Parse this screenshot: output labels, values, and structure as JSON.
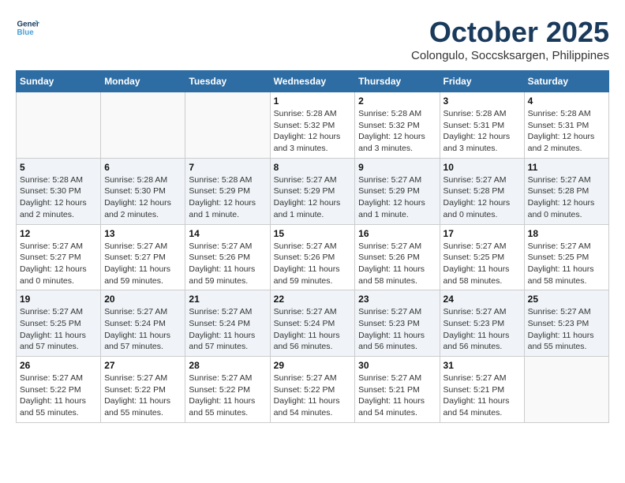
{
  "header": {
    "logo": {
      "line1": "General",
      "line2": "Blue"
    },
    "title": "October 2025",
    "subtitle": "Colongulo, Soccsksargen, Philippines"
  },
  "weekdays": [
    "Sunday",
    "Monday",
    "Tuesday",
    "Wednesday",
    "Thursday",
    "Friday",
    "Saturday"
  ],
  "weeks": [
    [
      {
        "day": "",
        "sunrise": "",
        "sunset": "",
        "daylight": ""
      },
      {
        "day": "",
        "sunrise": "",
        "sunset": "",
        "daylight": ""
      },
      {
        "day": "",
        "sunrise": "",
        "sunset": "",
        "daylight": ""
      },
      {
        "day": "1",
        "sunrise": "Sunrise: 5:28 AM",
        "sunset": "Sunset: 5:32 PM",
        "daylight": "Daylight: 12 hours and 3 minutes."
      },
      {
        "day": "2",
        "sunrise": "Sunrise: 5:28 AM",
        "sunset": "Sunset: 5:32 PM",
        "daylight": "Daylight: 12 hours and 3 minutes."
      },
      {
        "day": "3",
        "sunrise": "Sunrise: 5:28 AM",
        "sunset": "Sunset: 5:31 PM",
        "daylight": "Daylight: 12 hours and 3 minutes."
      },
      {
        "day": "4",
        "sunrise": "Sunrise: 5:28 AM",
        "sunset": "Sunset: 5:31 PM",
        "daylight": "Daylight: 12 hours and 2 minutes."
      }
    ],
    [
      {
        "day": "5",
        "sunrise": "Sunrise: 5:28 AM",
        "sunset": "Sunset: 5:30 PM",
        "daylight": "Daylight: 12 hours and 2 minutes."
      },
      {
        "day": "6",
        "sunrise": "Sunrise: 5:28 AM",
        "sunset": "Sunset: 5:30 PM",
        "daylight": "Daylight: 12 hours and 2 minutes."
      },
      {
        "day": "7",
        "sunrise": "Sunrise: 5:28 AM",
        "sunset": "Sunset: 5:29 PM",
        "daylight": "Daylight: 12 hours and 1 minute."
      },
      {
        "day": "8",
        "sunrise": "Sunrise: 5:27 AM",
        "sunset": "Sunset: 5:29 PM",
        "daylight": "Daylight: 12 hours and 1 minute."
      },
      {
        "day": "9",
        "sunrise": "Sunrise: 5:27 AM",
        "sunset": "Sunset: 5:29 PM",
        "daylight": "Daylight: 12 hours and 1 minute."
      },
      {
        "day": "10",
        "sunrise": "Sunrise: 5:27 AM",
        "sunset": "Sunset: 5:28 PM",
        "daylight": "Daylight: 12 hours and 0 minutes."
      },
      {
        "day": "11",
        "sunrise": "Sunrise: 5:27 AM",
        "sunset": "Sunset: 5:28 PM",
        "daylight": "Daylight: 12 hours and 0 minutes."
      }
    ],
    [
      {
        "day": "12",
        "sunrise": "Sunrise: 5:27 AM",
        "sunset": "Sunset: 5:27 PM",
        "daylight": "Daylight: 12 hours and 0 minutes."
      },
      {
        "day": "13",
        "sunrise": "Sunrise: 5:27 AM",
        "sunset": "Sunset: 5:27 PM",
        "daylight": "Daylight: 11 hours and 59 minutes."
      },
      {
        "day": "14",
        "sunrise": "Sunrise: 5:27 AM",
        "sunset": "Sunset: 5:26 PM",
        "daylight": "Daylight: 11 hours and 59 minutes."
      },
      {
        "day": "15",
        "sunrise": "Sunrise: 5:27 AM",
        "sunset": "Sunset: 5:26 PM",
        "daylight": "Daylight: 11 hours and 59 minutes."
      },
      {
        "day": "16",
        "sunrise": "Sunrise: 5:27 AM",
        "sunset": "Sunset: 5:26 PM",
        "daylight": "Daylight: 11 hours and 58 minutes."
      },
      {
        "day": "17",
        "sunrise": "Sunrise: 5:27 AM",
        "sunset": "Sunset: 5:25 PM",
        "daylight": "Daylight: 11 hours and 58 minutes."
      },
      {
        "day": "18",
        "sunrise": "Sunrise: 5:27 AM",
        "sunset": "Sunset: 5:25 PM",
        "daylight": "Daylight: 11 hours and 58 minutes."
      }
    ],
    [
      {
        "day": "19",
        "sunrise": "Sunrise: 5:27 AM",
        "sunset": "Sunset: 5:25 PM",
        "daylight": "Daylight: 11 hours and 57 minutes."
      },
      {
        "day": "20",
        "sunrise": "Sunrise: 5:27 AM",
        "sunset": "Sunset: 5:24 PM",
        "daylight": "Daylight: 11 hours and 57 minutes."
      },
      {
        "day": "21",
        "sunrise": "Sunrise: 5:27 AM",
        "sunset": "Sunset: 5:24 PM",
        "daylight": "Daylight: 11 hours and 57 minutes."
      },
      {
        "day": "22",
        "sunrise": "Sunrise: 5:27 AM",
        "sunset": "Sunset: 5:24 PM",
        "daylight": "Daylight: 11 hours and 56 minutes."
      },
      {
        "day": "23",
        "sunrise": "Sunrise: 5:27 AM",
        "sunset": "Sunset: 5:23 PM",
        "daylight": "Daylight: 11 hours and 56 minutes."
      },
      {
        "day": "24",
        "sunrise": "Sunrise: 5:27 AM",
        "sunset": "Sunset: 5:23 PM",
        "daylight": "Daylight: 11 hours and 56 minutes."
      },
      {
        "day": "25",
        "sunrise": "Sunrise: 5:27 AM",
        "sunset": "Sunset: 5:23 PM",
        "daylight": "Daylight: 11 hours and 55 minutes."
      }
    ],
    [
      {
        "day": "26",
        "sunrise": "Sunrise: 5:27 AM",
        "sunset": "Sunset: 5:22 PM",
        "daylight": "Daylight: 11 hours and 55 minutes."
      },
      {
        "day": "27",
        "sunrise": "Sunrise: 5:27 AM",
        "sunset": "Sunset: 5:22 PM",
        "daylight": "Daylight: 11 hours and 55 minutes."
      },
      {
        "day": "28",
        "sunrise": "Sunrise: 5:27 AM",
        "sunset": "Sunset: 5:22 PM",
        "daylight": "Daylight: 11 hours and 55 minutes."
      },
      {
        "day": "29",
        "sunrise": "Sunrise: 5:27 AM",
        "sunset": "Sunset: 5:22 PM",
        "daylight": "Daylight: 11 hours and 54 minutes."
      },
      {
        "day": "30",
        "sunrise": "Sunrise: 5:27 AM",
        "sunset": "Sunset: 5:21 PM",
        "daylight": "Daylight: 11 hours and 54 minutes."
      },
      {
        "day": "31",
        "sunrise": "Sunrise: 5:27 AM",
        "sunset": "Sunset: 5:21 PM",
        "daylight": "Daylight: 11 hours and 54 minutes."
      },
      {
        "day": "",
        "sunrise": "",
        "sunset": "",
        "daylight": ""
      }
    ]
  ]
}
